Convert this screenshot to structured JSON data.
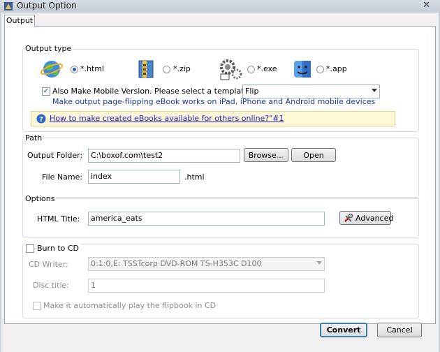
{
  "window": {
    "title": "Output Option"
  },
  "tabs": [
    {
      "label": "Output"
    }
  ],
  "output_type": {
    "group_label": "Output type",
    "options": [
      {
        "label": "*.html",
        "selected": true,
        "icon": "globe-icon"
      },
      {
        "label": "*.zip",
        "selected": false,
        "icon": "zip-archive-icon"
      },
      {
        "label": "*.exe",
        "selected": false,
        "icon": "gears-exe-icon"
      },
      {
        "label": "*.app",
        "selected": false,
        "icon": "mac-finder-icon"
      }
    ],
    "mobile_checkbox_label": "Also Make Mobile Version. Please select a template for mobile:",
    "mobile_checked": true,
    "mobile_template_value": "Flip",
    "mobile_hint": "Make output page-flipping eBook works on iPad, iPhone and Android mobile devices",
    "help_link": "How to make created eBooks available for others online?\"#1"
  },
  "path": {
    "group_label": "Path",
    "output_folder_label": "Output Folder:",
    "output_folder_value": "C:\\boxof.com\\test2",
    "browse_label": "Browse...",
    "open_label": "Open",
    "file_name_label": "File Name:",
    "file_name_value": "index",
    "file_ext": ".html"
  },
  "options": {
    "group_label": "Options",
    "html_title_label": "HTML Title:",
    "html_title_value": "america_eats",
    "advanced_label": "Advanced"
  },
  "burn": {
    "checkbox_label": "Burn to CD",
    "checked": false,
    "cd_writer_label": "CD Writer:",
    "cd_writer_value": "0:1:0,E: TSSTcorp DVD-ROM TS-H353C D100",
    "disc_title_label": "Disc title:",
    "disc_title_value": "1",
    "autoplay_label": "Make it automatically play the flipbook in CD"
  },
  "footer": {
    "convert_label": "Convert",
    "cancel_label": "Cancel"
  },
  "colors": {
    "link": "#1a1acc",
    "hint_text": "#1a3aa0",
    "help_box_bg": "#fdf7d6",
    "help_box_border": "#e4d28a"
  }
}
